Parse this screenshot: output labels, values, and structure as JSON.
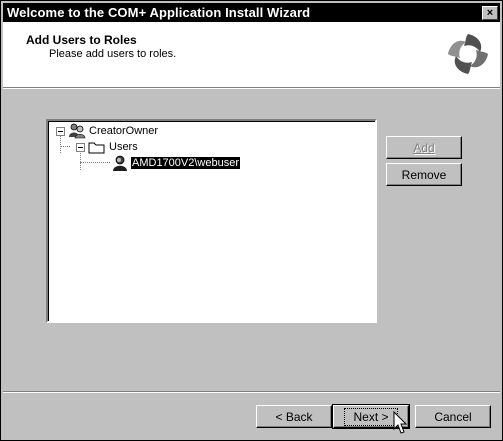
{
  "window": {
    "title": "Welcome to the COM+ Application Install Wizard",
    "close_glyph": "×"
  },
  "header": {
    "title": "Add Users to Roles",
    "subtitle": "Please add users to roles."
  },
  "tree": {
    "role": "CreatorOwner",
    "folder": "Users",
    "user": "AMD1700V2\\webuser"
  },
  "buttons": {
    "add": "Add",
    "remove": "Remove",
    "back": "< Back",
    "next": "Next >",
    "cancel": "Cancel"
  }
}
